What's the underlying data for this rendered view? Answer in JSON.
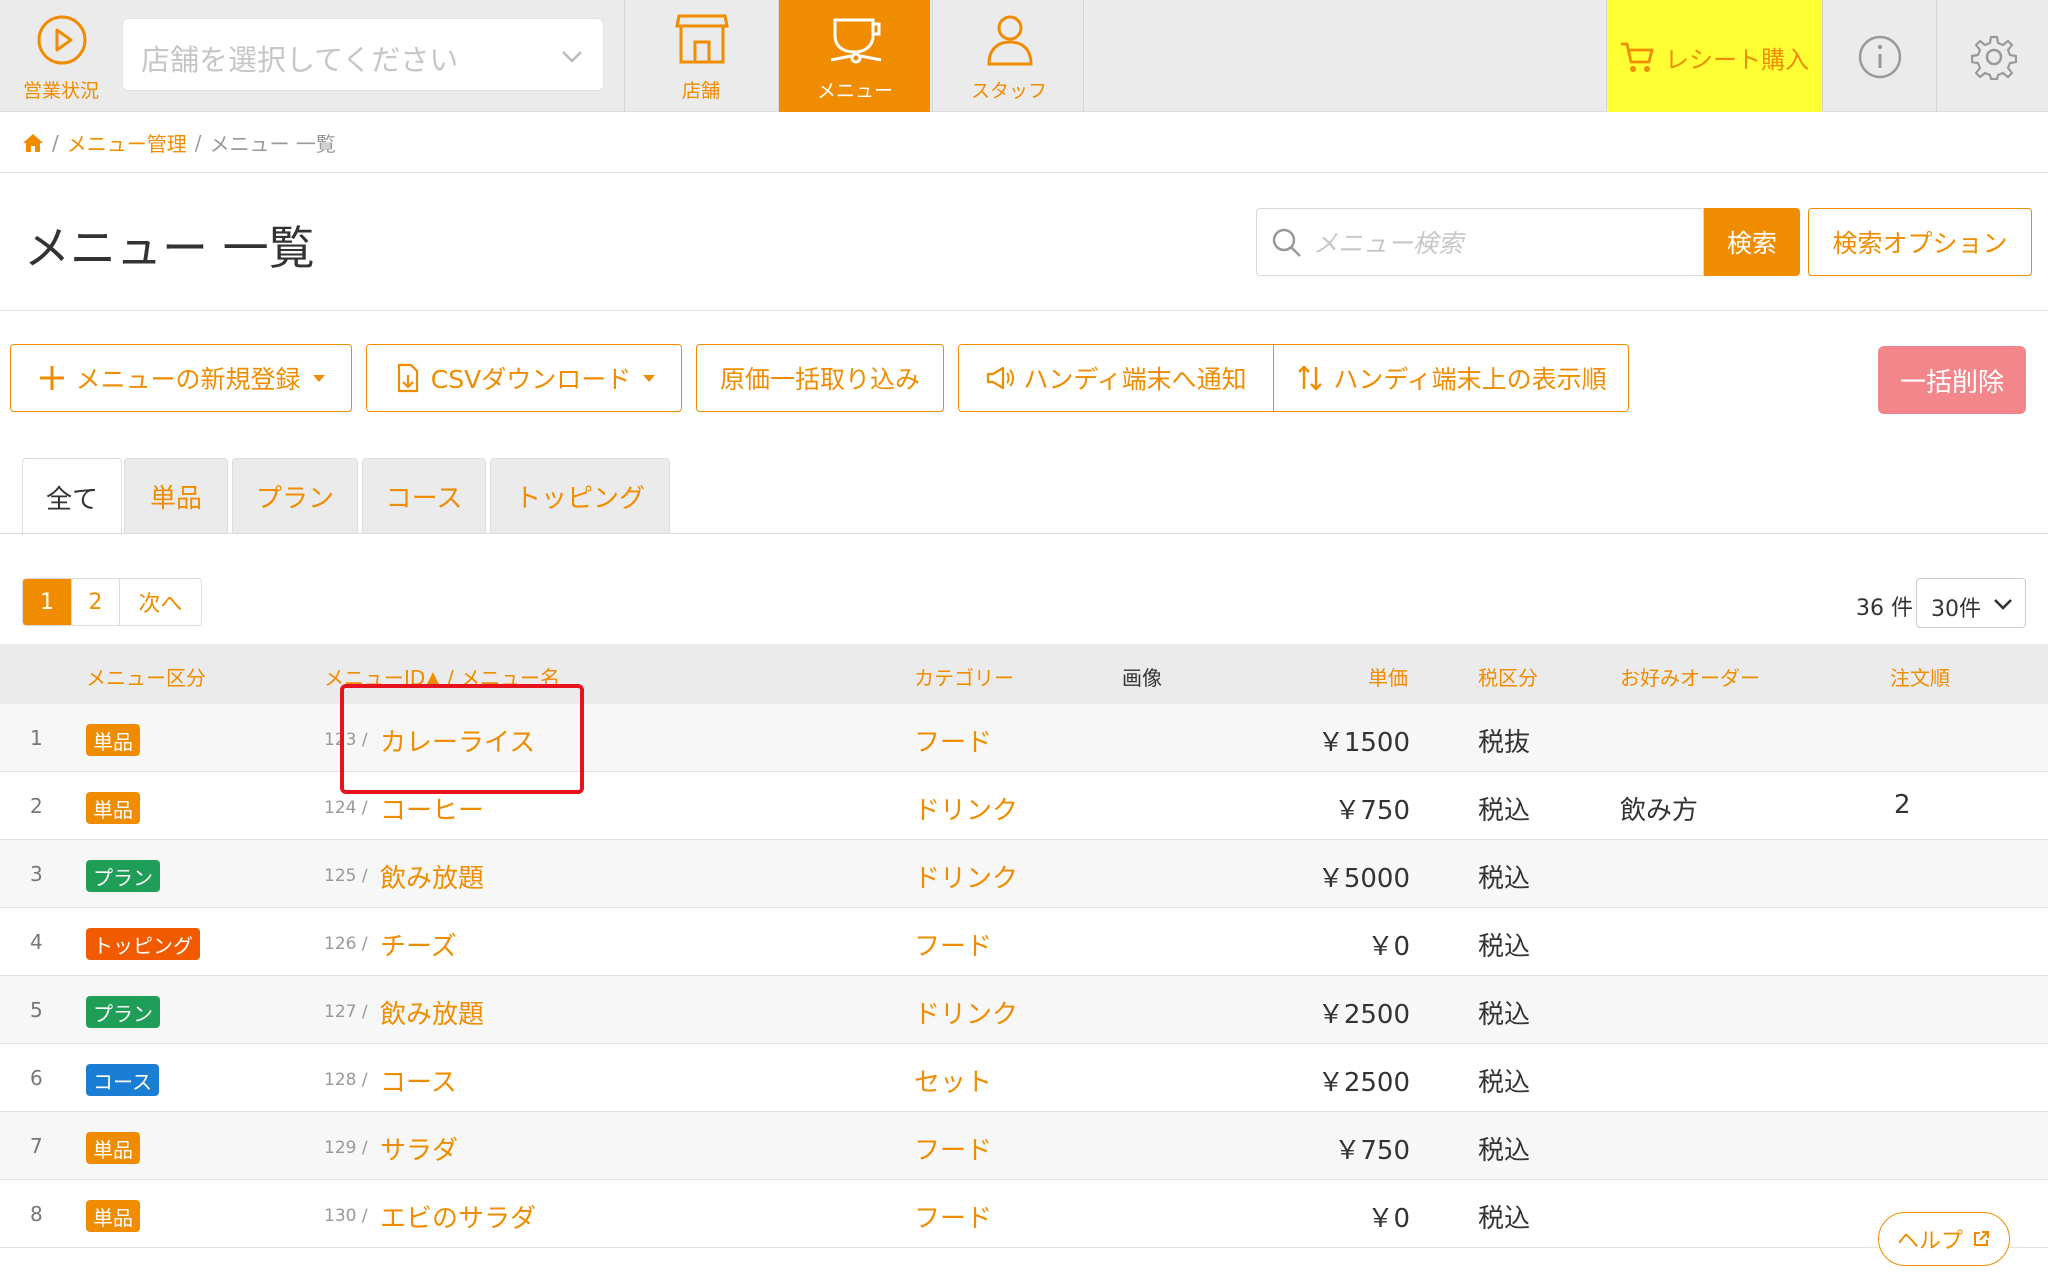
{
  "header": {
    "status_label": "営業状況",
    "shop_select_placeholder": "店舗を選択してください",
    "nav": [
      {
        "label": "店舗",
        "icon": "store-icon"
      },
      {
        "label": "メニュー",
        "icon": "cup-icon",
        "active": true
      },
      {
        "label": "スタッフ",
        "icon": "staff-icon"
      }
    ],
    "receipt_label": "レシート購入",
    "receipt_bg": "#ffff33"
  },
  "breadcrumb": {
    "items": [
      "メニュー管理",
      "メニュー 一覧"
    ]
  },
  "page_title": "メニュー 一覧",
  "search": {
    "placeholder": "メニュー検索",
    "button": "検索",
    "options_button": "検索オプション"
  },
  "actions": {
    "new_menu": "メニューの新規登録",
    "csv_download": "CSVダウンロード",
    "cost_import": "原価一括取り込み",
    "notify_handy": "ハンディ端末へ通知",
    "handy_order": "ハンディ端末上の表示順",
    "bulk_delete": "一括削除"
  },
  "tabs": [
    "全て",
    "単品",
    "プラン",
    "コース",
    "トッピング"
  ],
  "pagination": {
    "pages": [
      "1",
      "2"
    ],
    "next": "次へ",
    "total": "36 件",
    "per_page": "30件"
  },
  "table": {
    "headers": {
      "kind": "メニュー区分",
      "id_name": "メニューID▲ / メニュー名",
      "category": "カテゴリー",
      "image": "画像",
      "price": "単価",
      "tax": "税区分",
      "preference": "お好みオーダー",
      "order": "注文順"
    },
    "rows": [
      {
        "no": "1",
        "kind": "単品",
        "id": "123 /",
        "name": "カレーライス",
        "category": "フード",
        "price": "￥1500",
        "tax": "税抜",
        "preference": "",
        "order": ""
      },
      {
        "no": "2",
        "kind": "単品",
        "id": "124 /",
        "name": "コーヒー",
        "category": "ドリンク",
        "price": "￥750",
        "tax": "税込",
        "preference": "飲み方",
        "order": "2"
      },
      {
        "no": "3",
        "kind": "プラン",
        "id": "125 /",
        "name": "飲み放題",
        "category": "ドリンク",
        "price": "￥5000",
        "tax": "税込",
        "preference": "",
        "order": ""
      },
      {
        "no": "4",
        "kind": "トッピング",
        "id": "126 /",
        "name": "チーズ",
        "category": "フード",
        "price": "￥0",
        "tax": "税込",
        "preference": "",
        "order": ""
      },
      {
        "no": "5",
        "kind": "プラン",
        "id": "127 /",
        "name": "飲み放題",
        "category": "ドリンク",
        "price": "￥2500",
        "tax": "税込",
        "preference": "",
        "order": ""
      },
      {
        "no": "6",
        "kind": "コース",
        "id": "128 /",
        "name": "コース",
        "category": "セット",
        "price": "￥2500",
        "tax": "税込",
        "preference": "",
        "order": ""
      },
      {
        "no": "7",
        "kind": "単品",
        "id": "129 /",
        "name": "サラダ",
        "category": "フード",
        "price": "￥750",
        "tax": "税込",
        "preference": "",
        "order": ""
      },
      {
        "no": "8",
        "kind": "単品",
        "id": "130 /",
        "name": "エビのサラダ",
        "category": "フード",
        "price": "￥0",
        "tax": "税込",
        "preference": "",
        "order": ""
      }
    ]
  },
  "badge_colors": {
    "単品": "#f08c00",
    "プラン": "#1e9e57",
    "トッピング": "#f25a00",
    "コース": "#1a7fd4"
  },
  "help": "ヘルプ",
  "colors": {
    "accent": "#f08c00",
    "delete": "#f3868a",
    "highlight": "#e8141d"
  }
}
